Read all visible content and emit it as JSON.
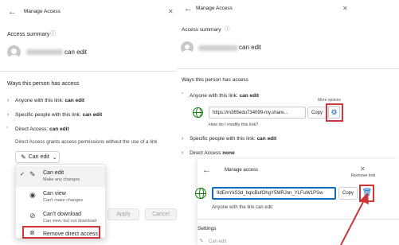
{
  "left": {
    "title": "Manage Access",
    "back_icon": "←",
    "close_icon": "✕",
    "access_summary": "Access summary",
    "info_icon": "ⓘ",
    "user_suffix": "can edit",
    "ways_heading": "Ways this person has access",
    "anyone_prefix": "Anyone with this link:",
    "anyone_value": "can edit",
    "specific_prefix": "Specific people with this link:",
    "specific_value": "can edit",
    "direct_prefix": "Direct Access:",
    "direct_value": "can edit",
    "direct_desc": "Direct Access grants access permissions without the use of a link",
    "dropdown_label": "Can edit",
    "apply": "Apply",
    "cancel": "Cancel",
    "menu": [
      {
        "label": "Can edit",
        "sub": "Make any changes",
        "icon": "pencil-icon",
        "glyph": "✎",
        "selected": true
      },
      {
        "label": "Can view",
        "sub": "Can't make changes",
        "icon": "eye-icon",
        "glyph": "◉",
        "selected": false
      },
      {
        "label": "Can't download",
        "sub": "Can view, but not download",
        "icon": "no-download-icon",
        "glyph": "⊘",
        "selected": false
      },
      {
        "label": "Remove direct access",
        "sub": "",
        "icon": "person-remove-icon",
        "glyph": "⊗",
        "selected": false
      }
    ],
    "check_glyph": "✓"
  },
  "right": {
    "title": "Manage Access",
    "back_icon": "←",
    "close_icon": "✕",
    "access_summary": "Access summary",
    "info_icon": "ⓘ",
    "user_suffix": "can edit",
    "ways_heading": "Ways this person has access",
    "anyone_prefix": "Anyone with this link:",
    "anyone_value": "can edit",
    "link_url": "https://m365edu734099-my.share...",
    "copy": "Copy",
    "more_options": "More options",
    "modify_link": "How do I modify this link?",
    "specific_prefix": "Specific people with this link:",
    "specific_value": "can edit",
    "direct_prefix": "Direct Access",
    "direct_value": "none"
  },
  "inner": {
    "title": "Manage access",
    "back_icon": "←",
    "close_icon": "✕",
    "link_value": "9dEmYkS3d_bqlcBufOhgY5MRJnn_YLFuW1PSw",
    "copy": "Copy",
    "remove_link": "Remove link",
    "anyone_text": "Anyone with the link can edit",
    "settings": "Settings",
    "can_edit": "Can edit"
  },
  "colors": {
    "accent": "#0f6cbd",
    "annotation": "#d13438",
    "globe": "#107c10"
  }
}
